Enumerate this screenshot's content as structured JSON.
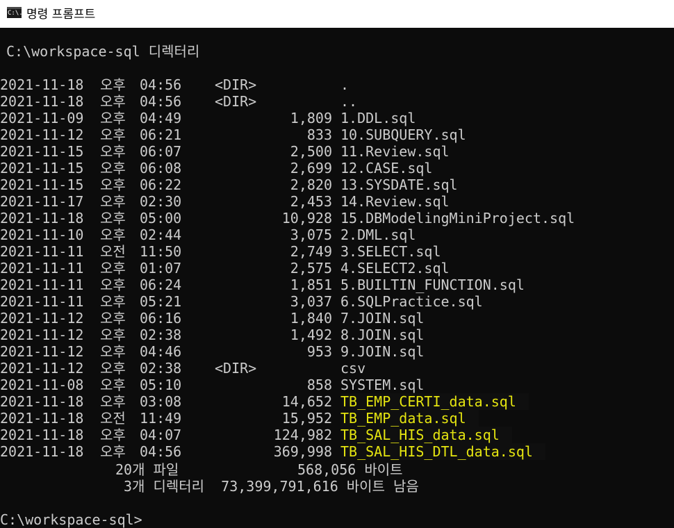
{
  "window": {
    "title": "명령 프롬프트",
    "icon": "cmd-icon",
    "icon_text": "C:\\."
  },
  "terminal": {
    "directory_header": "C:\\workspace-sql 디렉터리",
    "entries": [
      {
        "date": "2021-11-18",
        "ampm": "오후",
        "time": "04:56",
        "dir": "<DIR>",
        "size": "",
        "name": ".",
        "highlight": false
      },
      {
        "date": "2021-11-18",
        "ampm": "오후",
        "time": "04:56",
        "dir": "<DIR>",
        "size": "",
        "name": "..",
        "highlight": false
      },
      {
        "date": "2021-11-09",
        "ampm": "오후",
        "time": "04:49",
        "dir": "",
        "size": "1,809",
        "name": "1.DDL.sql",
        "highlight": false
      },
      {
        "date": "2021-11-12",
        "ampm": "오후",
        "time": "06:21",
        "dir": "",
        "size": "833",
        "name": "10.SUBQUERY.sql",
        "highlight": false
      },
      {
        "date": "2021-11-15",
        "ampm": "오후",
        "time": "06:07",
        "dir": "",
        "size": "2,500",
        "name": "11.Review.sql",
        "highlight": false
      },
      {
        "date": "2021-11-15",
        "ampm": "오후",
        "time": "06:08",
        "dir": "",
        "size": "2,699",
        "name": "12.CASE.sql",
        "highlight": false
      },
      {
        "date": "2021-11-15",
        "ampm": "오후",
        "time": "06:22",
        "dir": "",
        "size": "2,820",
        "name": "13.SYSDATE.sql",
        "highlight": false
      },
      {
        "date": "2021-11-17",
        "ampm": "오후",
        "time": "02:30",
        "dir": "",
        "size": "2,453",
        "name": "14.Review.sql",
        "highlight": false
      },
      {
        "date": "2021-11-18",
        "ampm": "오후",
        "time": "05:00",
        "dir": "",
        "size": "10,928",
        "name": "15.DBModelingMiniProject.sql",
        "highlight": false
      },
      {
        "date": "2021-11-10",
        "ampm": "오후",
        "time": "02:44",
        "dir": "",
        "size": "3,075",
        "name": "2.DML.sql",
        "highlight": false
      },
      {
        "date": "2021-11-11",
        "ampm": "오전",
        "time": "11:50",
        "dir": "",
        "size": "2,749",
        "name": "3.SELECT.sql",
        "highlight": false
      },
      {
        "date": "2021-11-11",
        "ampm": "오후",
        "time": "01:07",
        "dir": "",
        "size": "2,575",
        "name": "4.SELECT2.sql",
        "highlight": false
      },
      {
        "date": "2021-11-11",
        "ampm": "오후",
        "time": "06:24",
        "dir": "",
        "size": "1,851",
        "name": "5.BUILTIN_FUNCTION.sql",
        "highlight": false
      },
      {
        "date": "2021-11-11",
        "ampm": "오후",
        "time": "05:21",
        "dir": "",
        "size": "3,037",
        "name": "6.SQLPractice.sql",
        "highlight": false
      },
      {
        "date": "2021-11-12",
        "ampm": "오후",
        "time": "06:16",
        "dir": "",
        "size": "1,840",
        "name": "7.JOIN.sql",
        "highlight": false
      },
      {
        "date": "2021-11-12",
        "ampm": "오후",
        "time": "02:38",
        "dir": "",
        "size": "1,492",
        "name": "8.JOIN.sql",
        "highlight": false
      },
      {
        "date": "2021-11-12",
        "ampm": "오후",
        "time": "04:46",
        "dir": "",
        "size": "953",
        "name": "9.JOIN.sql",
        "highlight": false
      },
      {
        "date": "2021-11-12",
        "ampm": "오후",
        "time": "02:38",
        "dir": "<DIR>",
        "size": "",
        "name": "csv",
        "highlight": false
      },
      {
        "date": "2021-11-08",
        "ampm": "오후",
        "time": "05:10",
        "dir": "",
        "size": "858",
        "name": "SYSTEM.sql",
        "highlight": false
      },
      {
        "date": "2021-11-18",
        "ampm": "오후",
        "time": "03:08",
        "dir": "",
        "size": "14,652",
        "name": "TB_EMP_CERTI_data.sql",
        "highlight": true
      },
      {
        "date": "2021-11-18",
        "ampm": "오전",
        "time": "11:49",
        "dir": "",
        "size": "15,952",
        "name": "TB_EMP_data.sql",
        "highlight": true
      },
      {
        "date": "2021-11-18",
        "ampm": "오후",
        "time": "04:07",
        "dir": "",
        "size": "124,982",
        "name": "TB_SAL_HIS_data.sql",
        "highlight": true
      },
      {
        "date": "2021-11-18",
        "ampm": "오후",
        "time": "04:56",
        "dir": "",
        "size": "369,998",
        "name": "TB_SAL_HIS_DTL_data.sql",
        "highlight": true
      }
    ],
    "summary_files_count": "20개 파일",
    "summary_files_bytes": "568,056 바이트",
    "summary_dirs": "3개 디렉터리  73,399,791,616 바이트 남음",
    "prompt": "C:\\workspace-sql>",
    "highlight_color": "#e5e510",
    "text_color": "#cccccc"
  }
}
